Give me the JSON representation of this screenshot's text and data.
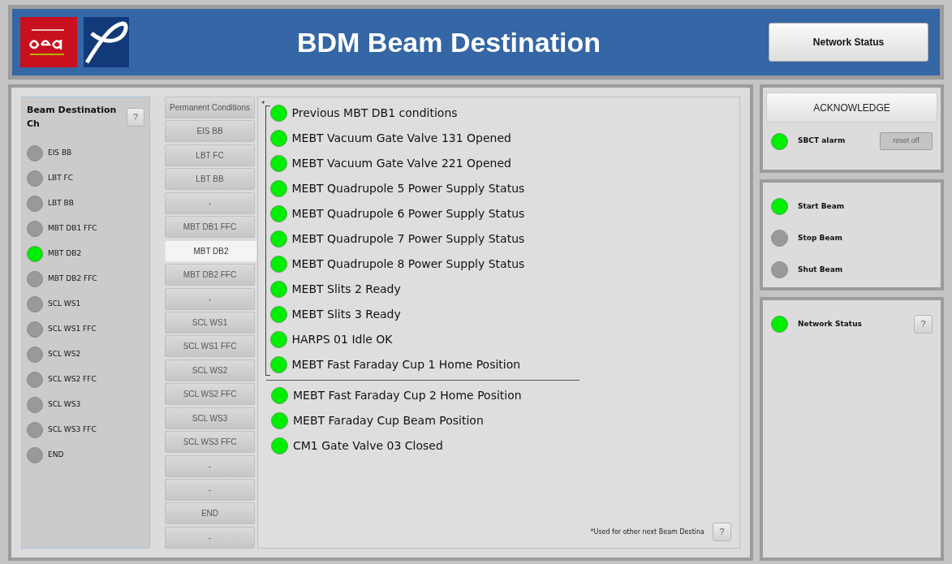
{
  "header": {
    "title": "BDM Beam Destination",
    "network_button": "Network Status"
  },
  "beam_destination": {
    "title": "Beam Destination Ch",
    "help": "?",
    "items": [
      {
        "label": "EIS BB",
        "on": false
      },
      {
        "label": "LBT FC",
        "on": false
      },
      {
        "label": "LBT BB",
        "on": false
      },
      {
        "label": "MBT DB1 FFC",
        "on": false
      },
      {
        "label": "MBT DB2",
        "on": true
      },
      {
        "label": "MBT DB2 FFC",
        "on": false
      },
      {
        "label": "SCL WS1",
        "on": false
      },
      {
        "label": "SCL WS1 FFC",
        "on": false
      },
      {
        "label": "SCL WS2",
        "on": false
      },
      {
        "label": "SCL WS2 FFC",
        "on": false
      },
      {
        "label": "SCL WS3",
        "on": false
      },
      {
        "label": "SCL WS3 FFC",
        "on": false
      },
      {
        "label": "END",
        "on": false
      }
    ]
  },
  "condition_tabs": [
    {
      "label": "Permanent Conditions",
      "selected": false
    },
    {
      "label": "EIS BB",
      "selected": false
    },
    {
      "label": "LBT FC",
      "selected": false
    },
    {
      "label": "LBT BB",
      "selected": false
    },
    {
      "label": "-",
      "selected": false
    },
    {
      "label": "MBT DB1 FFC",
      "selected": false
    },
    {
      "label": "MBT DB2",
      "selected": true
    },
    {
      "label": "MBT DB2 FFC",
      "selected": false
    },
    {
      "label": "-",
      "selected": false
    },
    {
      "label": "SCL WS1",
      "selected": false
    },
    {
      "label": "SCL WS1 FFC",
      "selected": false
    },
    {
      "label": "SCL WS2",
      "selected": false
    },
    {
      "label": "SCL WS2 FFC",
      "selected": false
    },
    {
      "label": "SCL WS3",
      "selected": false
    },
    {
      "label": "SCL WS3 FFC",
      "selected": false
    },
    {
      "label": "-",
      "selected": false
    },
    {
      "label": "-",
      "selected": false
    },
    {
      "label": "END",
      "selected": false
    },
    {
      "label": "-",
      "selected": false
    }
  ],
  "conditions": {
    "marker": "*",
    "starred": [
      {
        "label": "Previous MBT DB1 conditions",
        "on": true
      },
      {
        "label": "MEBT Vacuum Gate Valve 131 Opened",
        "on": true
      },
      {
        "label": "MEBT Vacuum Gate Valve 221 Opened",
        "on": true
      },
      {
        "label": "MEBT Quadrupole 5 Power Supply Status",
        "on": true
      },
      {
        "label": "MEBT Quadrupole 6 Power Supply Status",
        "on": true
      },
      {
        "label": "MEBT Quadrupole 7 Power Supply Status",
        "on": true
      },
      {
        "label": "MEBT Quadrupole 8 Power Supply Status",
        "on": true
      },
      {
        "label": "MEBT Slits 2 Ready",
        "on": true
      },
      {
        "label": "MEBT Slits 3 Ready",
        "on": true
      },
      {
        "label": "HARPS 01 Idle OK",
        "on": true
      },
      {
        "label": "MEBT Fast Faraday Cup 1 Home Position",
        "on": true
      }
    ],
    "others": [
      {
        "label": "MEBT Fast Faraday Cup 2 Home Position",
        "on": true
      },
      {
        "label": "MEBT Faraday Cup Beam Position",
        "on": true
      },
      {
        "label": "CM1 Gate Valve 03 Closed",
        "on": true
      }
    ],
    "footnote": "*Used for other next Beam Destina",
    "help": "?"
  },
  "alarm": {
    "acknowledge": "ACKNOWLEDGE",
    "label": "SBCT alarm",
    "on": true,
    "reset": "reset off"
  },
  "beam": [
    {
      "label": "Start Beam",
      "on": true
    },
    {
      "label": "Stop Beam",
      "on": false
    },
    {
      "label": "Shut Beam",
      "on": false
    }
  ],
  "network": {
    "label": "Network Status",
    "on": true,
    "help": "?"
  }
}
